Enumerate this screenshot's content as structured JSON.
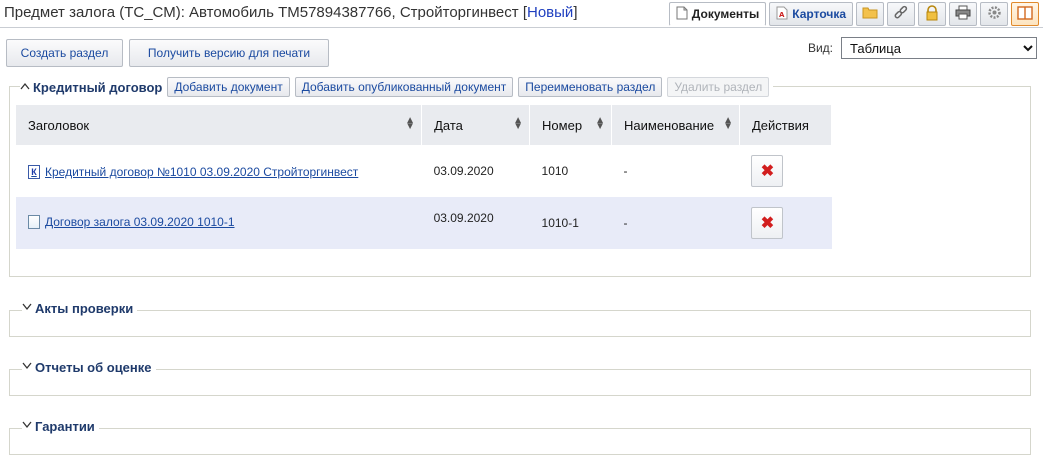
{
  "header": {
    "title": "Предмет залога (ТС_СМ): Автомобиль ТМ57894387766, Стройторгинвест",
    "status_open": "[",
    "status": "Новый",
    "status_close": "]"
  },
  "tabs": [
    {
      "label": "Документы",
      "icon": "document-icon",
      "active": true
    },
    {
      "label": "Карточка",
      "icon": "pdf-card-icon",
      "active": false
    }
  ],
  "tool_icons": [
    "folder-icon",
    "link-icon",
    "lock-icon",
    "print-icon",
    "settings-icon",
    "layout-icon"
  ],
  "actions": {
    "create_section": "Создать раздел",
    "print_version": "Получить версию для печати"
  },
  "view": {
    "label": "Вид:",
    "selected": "Таблица"
  },
  "sections": [
    {
      "title": "Кредитный договор",
      "expanded": true,
      "buttons": {
        "add_document": "Добавить документ",
        "add_published": "Добавить опубликованный документ",
        "rename": "Переименовать раздел",
        "delete": "Удалить раздел"
      },
      "columns": [
        "Заголовок",
        "Дата",
        "Номер",
        "Наименование",
        "Действия"
      ],
      "rows": [
        {
          "title": "Кредитный договор №1010 03.09.2020 Стройторгинвест",
          "icon": "credit-doc-icon",
          "icon_letter": "К",
          "date": "03.09.2020",
          "number": "1010",
          "name": "-"
        },
        {
          "title": "Договор залога 03.09.2020 1010-1",
          "icon": "file-doc-icon",
          "icon_letter": "",
          "date": "03.09.2020",
          "number": "1010-1",
          "name": "-"
        }
      ]
    },
    {
      "title": "Акты проверки",
      "expanded": false
    },
    {
      "title": "Отчеты об оценке",
      "expanded": false
    },
    {
      "title": "Гарантии",
      "expanded": false
    }
  ],
  "colors": {
    "link": "#1b4aa0",
    "delete": "#d21e1e",
    "row_alt": "#e8ebf8",
    "header_bg": "#e9ebef"
  }
}
